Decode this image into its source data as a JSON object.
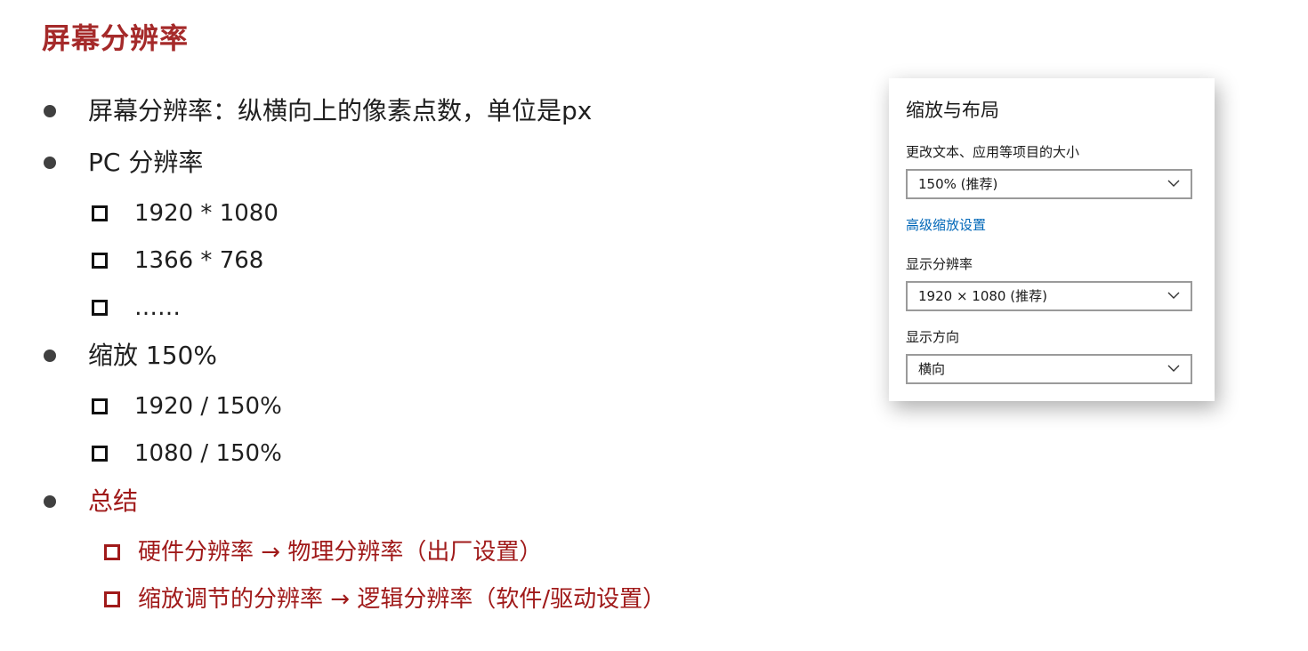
{
  "slide": {
    "title": "屏幕分辨率"
  },
  "bullets": [
    {
      "text": "屏幕分辨率：纵横向上的像素点数，单位是px"
    },
    {
      "text": "PC 分辨率",
      "sub": [
        "1920 * 1080",
        "1366 * 768",
        "……"
      ]
    },
    {
      "text": "缩放 150%",
      "sub": [
        "1920 / 150%",
        "1080 / 150%"
      ]
    },
    {
      "text": "总结",
      "sub": [
        "硬件分辨率 → 物理分辨率（出厂设置）",
        "缩放调节的分辨率 → 逻辑分辨率（软件/驱动设置）"
      ]
    }
  ],
  "panel": {
    "title": "缩放与布局",
    "scale_label": "更改文本、应用等项目的大小",
    "scale_value": "150% (推荐)",
    "advanced_link": "高级缩放设置",
    "resolution_label": "显示分辨率",
    "resolution_value": "1920 × 1080 (推荐)",
    "orientation_label": "显示方向",
    "orientation_value": "横向"
  },
  "colors": {
    "accent": "#a52a2a",
    "link": "#0067b8"
  },
  "icons": {
    "bullet": "filled-circle",
    "sub_bullet": "hollow-square",
    "dropdown": "chevron-down-icon"
  }
}
